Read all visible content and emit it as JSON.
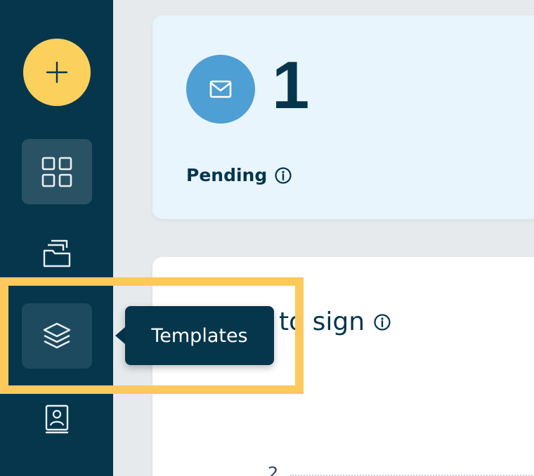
{
  "sidebar": {
    "items": [
      {
        "id": "add",
        "icon": "plus-icon"
      },
      {
        "id": "dashboard",
        "icon": "grid-icon",
        "active": true
      },
      {
        "id": "documents",
        "icon": "folder-icon"
      },
      {
        "id": "templates",
        "icon": "layers-icon",
        "hover": true
      },
      {
        "id": "contacts",
        "icon": "contact-book-icon"
      }
    ]
  },
  "pending_card": {
    "icon": "mail-icon",
    "count": "1",
    "label": "Pending",
    "info_icon": "info-icon"
  },
  "sign_card": {
    "title_visible": "to sign",
    "info_icon": "info-icon",
    "axis_tick": "2"
  },
  "tooltip": {
    "text": "Templates"
  },
  "colors": {
    "sidebar_bg": "#05364c",
    "accent_yellow": "#fcd05c",
    "mail_blue": "#4d9fd4",
    "pending_card_bg": "#e9f5fd",
    "highlight": "#fdc95c"
  }
}
